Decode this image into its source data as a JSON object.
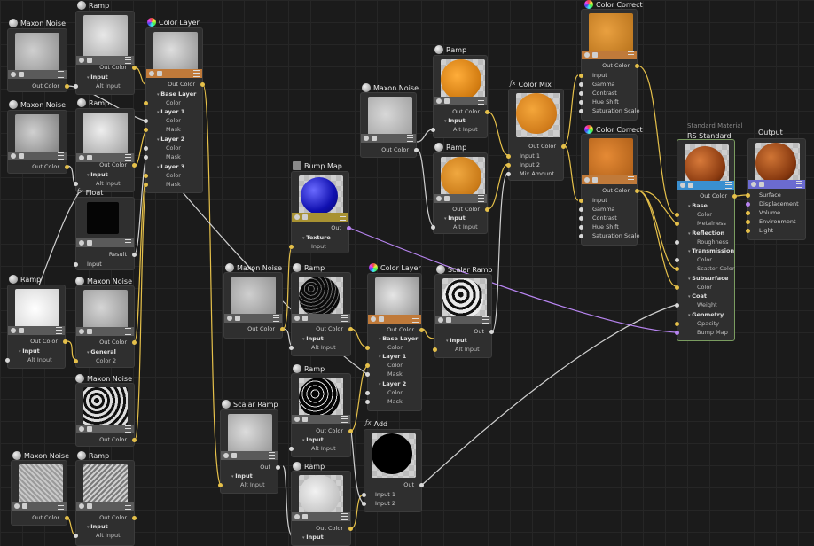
{
  "colors": {
    "background": "#1b1b1b",
    "wire_yellow": "#e5c04a",
    "wire_white": "#d0d0d0",
    "wire_purple": "#b784f0",
    "toolbar_gray": "#5a5a5a",
    "toolbar_orange": "#c07a3a",
    "toolbar_yellow": "#a89232",
    "toolbar_blue": "#3a8fd0",
    "toolbar_violet": "#6b6bd0",
    "selected_border": "#7a9c60"
  },
  "nodes": {
    "maxon_noise_1": {
      "title": "Maxon Noise",
      "out": "Out Color"
    },
    "maxon_noise_2": {
      "title": "Maxon Noise",
      "out": "Out Color"
    },
    "ramp_1": {
      "title": "Ramp",
      "out": "Out Color",
      "sec": "Input",
      "alt": "Alt Input"
    },
    "ramp_2": {
      "title": "Ramp",
      "out": "Out Color",
      "sec": "Input",
      "alt": "Alt Input"
    },
    "color_layer_1": {
      "title": "Color Layer",
      "out": "Out Color",
      "base": "Base Layer",
      "color": "Color",
      "l1": "Layer 1",
      "l2": "Layer 2",
      "l3": "Layer 3",
      "mask": "Mask"
    },
    "float_1": {
      "title": "Float",
      "out": "Result",
      "in": "Input"
    },
    "ramp_3": {
      "title": "Ramp",
      "out": "Out Color",
      "sec": "Input",
      "alt": "Alt Input"
    },
    "maxon_noise_3": {
      "title": "Maxon Noise",
      "out": "Out Color",
      "sec": "General",
      "color2": "Color 2"
    },
    "maxon_noise_4": {
      "title": "Maxon Noise",
      "out": "Out Color"
    },
    "maxon_noise_5": {
      "title": "Maxon Noise",
      "out": "Out Color"
    },
    "ramp_4": {
      "title": "Ramp",
      "out": "Out Color",
      "sec": "Input",
      "alt": "Alt Input"
    },
    "maxon_noise_6": {
      "title": "Maxon Noise",
      "out": "Out Color"
    },
    "bump_map": {
      "title": "Bump Map",
      "out": "Out",
      "sec": "Texture",
      "in": "Input"
    },
    "maxon_noise_7": {
      "title": "Maxon Noise",
      "out": "Out Color"
    },
    "ramp_5": {
      "title": "Ramp",
      "out": "Out Color",
      "sec": "Input",
      "alt": "Alt Input"
    },
    "ramp_6": {
      "title": "Ramp",
      "out": "Out Color",
      "sec": "Input",
      "alt": "Alt Input"
    },
    "ramp_7": {
      "title": "Ramp",
      "out": "Out Color",
      "sec": "Input"
    },
    "scalar_ramp_1": {
      "title": "Scalar Ramp",
      "out": "Out",
      "sec": "Input",
      "alt": "Alt Input"
    },
    "color_layer_2": {
      "title": "Color Layer",
      "out": "Out Color",
      "base": "Base Layer",
      "color": "Color",
      "l1": "Layer 1",
      "l2": "Layer 2",
      "mask": "Mask"
    },
    "scalar_ramp_2": {
      "title": "Scalar Ramp",
      "out": "Out",
      "sec": "Input",
      "alt": "Alt Input"
    },
    "add_1": {
      "title": "Add",
      "out": "Out",
      "in1": "Input 1",
      "in2": "Input 2"
    },
    "maxon_noise_8": {
      "title": "Maxon Noise",
      "out": "Out Color"
    },
    "ramp_8": {
      "title": "Ramp",
      "out": "Out Color",
      "sec": "Input",
      "alt": "Alt Input"
    },
    "ramp_9": {
      "title": "Ramp",
      "out": "Out Color",
      "sec": "Input",
      "alt": "Alt Input"
    },
    "color_mix": {
      "title": "Color Mix",
      "out": "Out Color",
      "in1": "Input 1",
      "in2": "Input 2",
      "mix": "Mix Amount"
    },
    "color_correct_1": {
      "title": "Color Correct",
      "out": "Out Color",
      "p": [
        "Input",
        "Gamma",
        "Contrast",
        "Hue Shift",
        "Saturation Scale"
      ]
    },
    "color_correct_2": {
      "title": "Color Correct",
      "out": "Out Color",
      "p": [
        "Input",
        "Gamma",
        "Contrast",
        "Hue Shift",
        "Saturation Scale"
      ]
    },
    "rs_standard": {
      "subtitle": "Standard Material",
      "title": "RS Standard",
      "out": "Out Color",
      "base": "Base",
      "metalness": "Metalness",
      "reflection": "Reflection",
      "roughness": "Roughness",
      "transmission": "Transmission",
      "color": "Color",
      "scatter": "Scatter Color",
      "subsurface": "Subsurface",
      "coat": "Coat",
      "weight": "Weight",
      "geometry": "Geometry",
      "opacity": "Opacity",
      "bump": "Bump Map"
    },
    "output": {
      "title": "Output",
      "p": [
        "Surface",
        "Displacement",
        "Volume",
        "Environment",
        "Light"
      ]
    }
  }
}
